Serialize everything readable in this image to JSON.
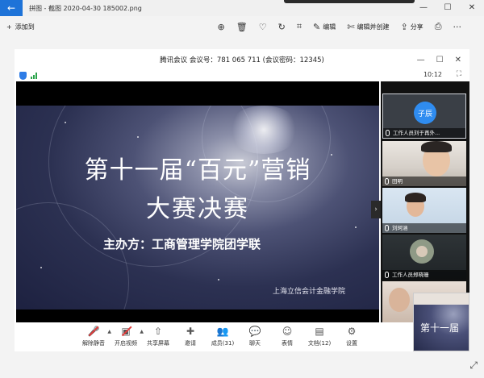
{
  "app": {
    "title": "拼图 - 截图 2020-04-30 185002.png",
    "back_glyph": "←",
    "window_controls": [
      "—",
      "☐",
      "✕"
    ]
  },
  "toolbar": {
    "add_label": "添加到",
    "actions": [
      {
        "icon": "zoom-in-icon",
        "glyph": "⊕",
        "label": ""
      },
      {
        "icon": "delete-icon",
        "glyph": "🗑",
        "label": ""
      },
      {
        "icon": "heart-icon",
        "glyph": "♡",
        "label": ""
      },
      {
        "icon": "rotate-icon",
        "glyph": "↻",
        "label": ""
      },
      {
        "icon": "crop-icon",
        "glyph": "⌗",
        "label": ""
      },
      {
        "icon": "edit-icon",
        "glyph": "✎",
        "label": "编辑"
      },
      {
        "icon": "create-icon",
        "glyph": "✄",
        "label": "编辑并创建"
      },
      {
        "icon": "share-icon",
        "glyph": "⇪",
        "label": "分享"
      },
      {
        "icon": "print-icon",
        "glyph": "⎙",
        "label": ""
      },
      {
        "icon": "more-icon",
        "glyph": "···",
        "label": ""
      }
    ]
  },
  "meeting": {
    "header": "腾讯会议  会议号：781 065 711  (会议密码：12345)",
    "controls": [
      "—",
      "☐",
      "✕"
    ],
    "time": "10:12",
    "fullscreen_glyph": "⛶"
  },
  "slide": {
    "title": "第十一届“百元”营销",
    "subtitle": "大赛决赛",
    "organizer": "主办方：工商管理学院团学联",
    "footer": "上海立信会计金融学院",
    "arrow": "›"
  },
  "participants": [
    {
      "name": "工作人员刘于苒外...",
      "avatar": "子辰"
    },
    {
      "name": "田明"
    },
    {
      "name": "刘珂涵"
    },
    {
      "name": "工作人员郑晓珊"
    },
    {
      "name": ""
    }
  ],
  "bottom_toolbar": [
    {
      "name": "mute-button",
      "glyph": "🎤",
      "label": "解除静音",
      "caret": true,
      "muted": true
    },
    {
      "name": "video-button",
      "glyph": "▣",
      "label": "开启视频",
      "caret": true,
      "muted": true
    },
    {
      "name": "share-screen-button",
      "glyph": "⇧",
      "label": "共享屏幕",
      "caret": false
    },
    {
      "name": "invite-button",
      "glyph": "✚",
      "label": "邀请",
      "caret": false
    },
    {
      "name": "members-button",
      "glyph": "👥",
      "label": "成员(31)",
      "caret": false
    },
    {
      "name": "chat-button",
      "glyph": "💬",
      "label": "聊天",
      "caret": false
    },
    {
      "name": "reaction-button",
      "glyph": "☺",
      "label": "表情",
      "caret": false
    },
    {
      "name": "docs-button",
      "glyph": "▤",
      "label": "文档(12)",
      "caret": false
    },
    {
      "name": "settings-button",
      "glyph": "⚙",
      "label": "设置",
      "caret": false
    }
  ],
  "pip": {
    "text": "第十一届"
  },
  "expand_glyph": "⤢"
}
